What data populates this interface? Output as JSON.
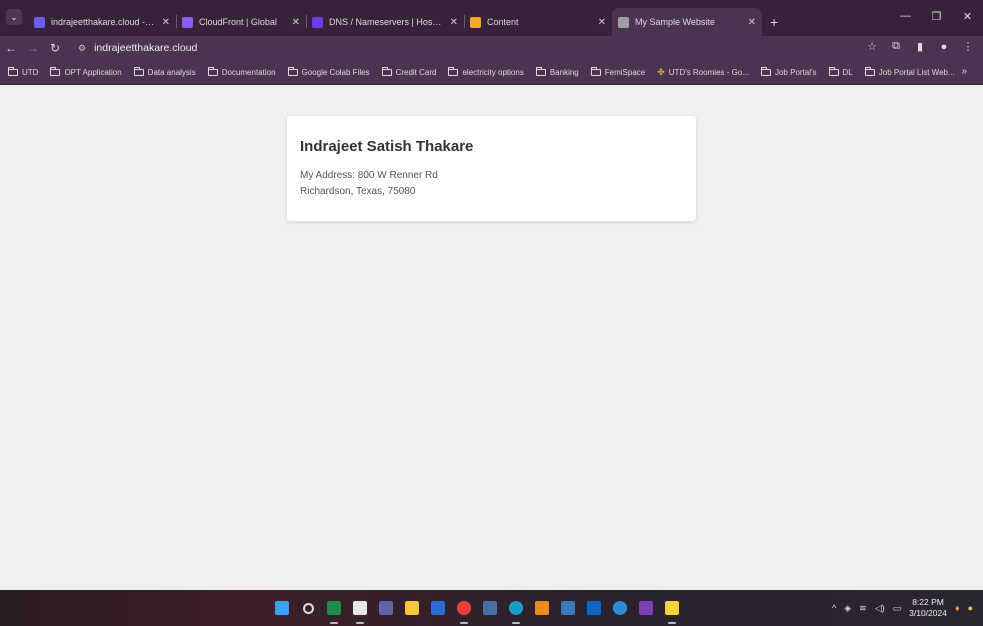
{
  "browser": {
    "tabs": [
      {
        "title": "indrajeetthakare.cloud - details",
        "color": "#6f5cf0",
        "active": false
      },
      {
        "title": "CloudFront | Global",
        "color": "#8b5cf6",
        "active": false
      },
      {
        "title": "DNS / Nameservers | Hostinger",
        "color": "#673de6",
        "active": false
      },
      {
        "title": "Content",
        "color": "#f9a825",
        "active": false
      },
      {
        "title": "My Sample Website",
        "color": "#9aa0a6",
        "active": true
      }
    ],
    "new_tab_glyph": "+",
    "window_controls": {
      "minimize": "—",
      "restore": "❐",
      "close": "✕"
    },
    "address": "indrajeetthakare.cloud",
    "bookmarks": [
      {
        "label": "UTD",
        "type": "folder"
      },
      {
        "label": "OPT Application",
        "type": "folder"
      },
      {
        "label": "Data analysis",
        "type": "folder"
      },
      {
        "label": "Documentation",
        "type": "folder"
      },
      {
        "label": "Google Colab Files",
        "type": "folder"
      },
      {
        "label": "Credit Card",
        "type": "folder"
      },
      {
        "label": "electricity options",
        "type": "folder"
      },
      {
        "label": "Banking",
        "type": "folder"
      },
      {
        "label": "FemiSpace",
        "type": "folder"
      },
      {
        "label": "UTD's Roomies - Go...",
        "type": "link"
      },
      {
        "label": "Job Portal's",
        "type": "folder"
      },
      {
        "label": "DL",
        "type": "folder"
      },
      {
        "label": "Job Portal List Web...",
        "type": "folder"
      }
    ],
    "bookmarks_overflow": "»"
  },
  "page": {
    "name": "Indrajeet Satish Thakare",
    "address_line1": "My Address: 800 W Renner Rd",
    "address_line2": "Richardson, Texas, 75080"
  },
  "taskbar": {
    "apps": [
      {
        "icon": "windows-start-icon",
        "color": "#3aa0ff"
      },
      {
        "icon": "search-icon",
        "color": "#dddddd"
      },
      {
        "icon": "excel-icon",
        "color": "#1f8a4c"
      },
      {
        "icon": "calendar-icon",
        "color": "#e7e7e7"
      },
      {
        "icon": "teams-icon",
        "color": "#6264a7"
      },
      {
        "icon": "file-explorer-icon",
        "color": "#f5c242"
      },
      {
        "icon": "word-icon",
        "color": "#2b6cd4"
      },
      {
        "icon": "chrome-icon",
        "color": "#e94235"
      },
      {
        "icon": "mail-icon",
        "color": "#4a6fa5"
      },
      {
        "icon": "edge-icon",
        "color": "#1aa0c8"
      },
      {
        "icon": "sublime-icon",
        "color": "#f28c1f"
      },
      {
        "icon": "python-icon",
        "color": "#3b78b7"
      },
      {
        "icon": "linkedin-icon",
        "color": "#0a66c2"
      },
      {
        "icon": "media-icon",
        "color": "#2b8fd6"
      },
      {
        "icon": "onenote-icon",
        "color": "#7b3fb5"
      },
      {
        "icon": "sticky-notes-icon",
        "color": "#f8d33a"
      }
    ],
    "time": "8:22 PM",
    "date": "3/10/2024"
  }
}
